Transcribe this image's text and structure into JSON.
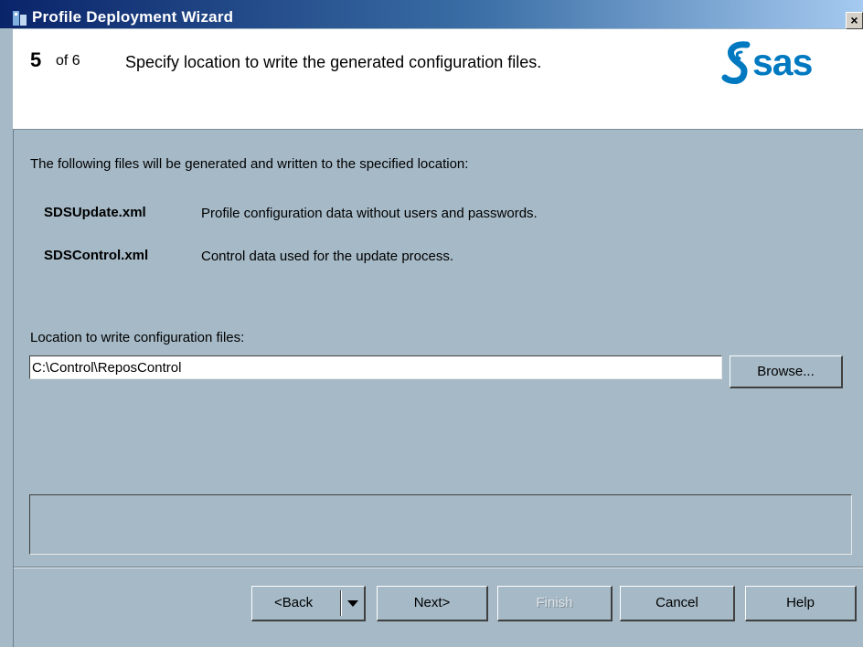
{
  "window": {
    "title": "Profile Deployment Wizard",
    "close_label": "×"
  },
  "header": {
    "step_number": "5",
    "step_of": "of 6",
    "step_description": "Specify location to write the generated configuration files.",
    "logo_text": "sas",
    "logo_color": "#0079c1"
  },
  "content": {
    "intro": "The following files will be generated and written to the specified location:",
    "files": [
      {
        "name": "SDSUpdate.xml",
        "description": "Profile configuration data without users and passwords."
      },
      {
        "name": "SDSControl.xml",
        "description": "Control data used for the update process."
      }
    ],
    "location_label": "Location to write configuration files:",
    "location_value": "C:\\Control\\ReposControl",
    "browse_label": "Browse..."
  },
  "buttons": {
    "back_label": "<Back",
    "next_label": "Next>",
    "finish_label": "Finish",
    "cancel_label": "Cancel",
    "help_label": "Help"
  },
  "colors": {
    "background": "#a5b9c6",
    "titlebar": "#0a246a",
    "header_background": "#ffffff"
  }
}
